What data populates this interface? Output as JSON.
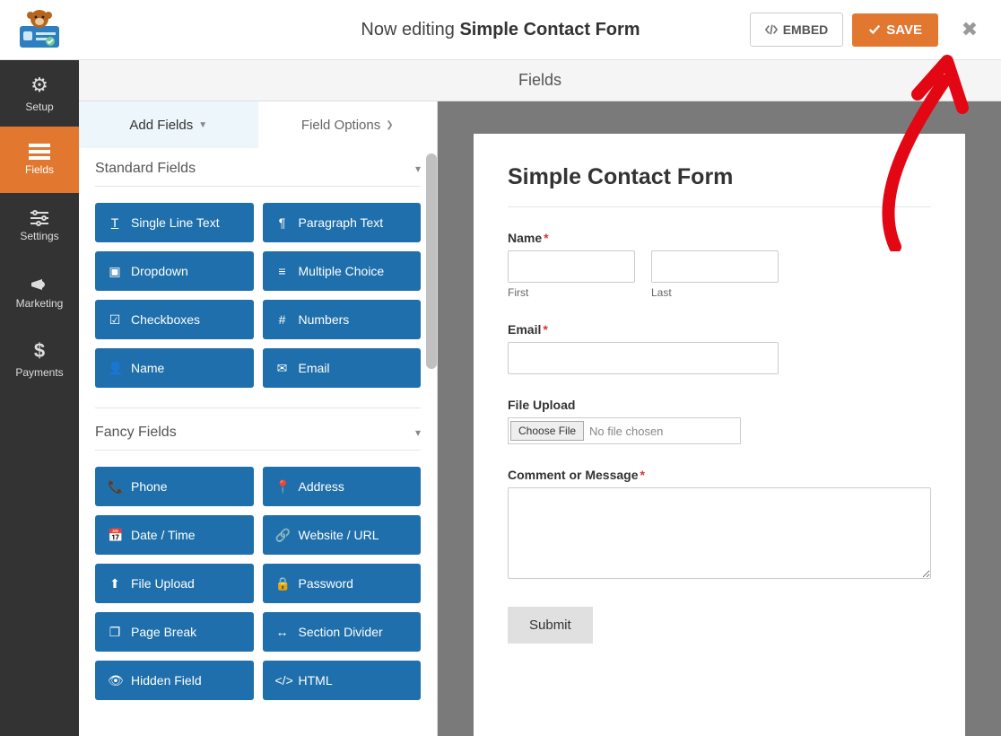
{
  "topbar": {
    "editing_prefix": "Now editing ",
    "form_name": "Simple Contact Form",
    "embed_label": "EMBED",
    "save_label": "SAVE"
  },
  "sidenav": {
    "items": [
      {
        "label": "Setup",
        "icon": "gear-icon"
      },
      {
        "label": "Fields",
        "icon": "list-icon",
        "active": true
      },
      {
        "label": "Settings",
        "icon": "sliders-icon"
      },
      {
        "label": "Marketing",
        "icon": "megaphone-icon"
      },
      {
        "label": "Payments",
        "icon": "dollar-icon"
      }
    ]
  },
  "subheader": {
    "title": "Fields"
  },
  "panel": {
    "tabs": {
      "add_fields": "Add Fields",
      "field_options": "Field Options"
    },
    "groups": {
      "standard_title": "Standard Fields",
      "fancy_title": "Fancy Fields"
    },
    "standard_fields": [
      {
        "label": "Single Line Text",
        "icon": "text-icon"
      },
      {
        "label": "Paragraph Text",
        "icon": "paragraph-icon"
      },
      {
        "label": "Dropdown",
        "icon": "dropdown-icon"
      },
      {
        "label": "Multiple Choice",
        "icon": "list-ul-icon"
      },
      {
        "label": "Checkboxes",
        "icon": "check-icon"
      },
      {
        "label": "Numbers",
        "icon": "hash-icon"
      },
      {
        "label": "Name",
        "icon": "user-icon"
      },
      {
        "label": "Email",
        "icon": "mail-icon"
      }
    ],
    "fancy_fields": [
      {
        "label": "Phone",
        "icon": "phone-icon"
      },
      {
        "label": "Address",
        "icon": "pin-icon"
      },
      {
        "label": "Date / Time",
        "icon": "calendar-icon"
      },
      {
        "label": "Website / URL",
        "icon": "link-icon"
      },
      {
        "label": "File Upload",
        "icon": "upload-icon"
      },
      {
        "label": "Password",
        "icon": "lock-icon"
      },
      {
        "label": "Page Break",
        "icon": "files-icon"
      },
      {
        "label": "Section Divider",
        "icon": "arrows-h-icon"
      },
      {
        "label": "Hidden Field",
        "icon": "eye-slash-icon"
      },
      {
        "label": "HTML",
        "icon": "code-icon"
      }
    ]
  },
  "form": {
    "title": "Simple Contact Form",
    "name_label": "Name",
    "first_sub": "First",
    "last_sub": "Last",
    "email_label": "Email",
    "file_label": "File Upload",
    "file_button": "Choose File",
    "file_placeholder": "No file chosen",
    "comment_label": "Comment or Message",
    "submit_label": "Submit",
    "required_marker": "*"
  }
}
